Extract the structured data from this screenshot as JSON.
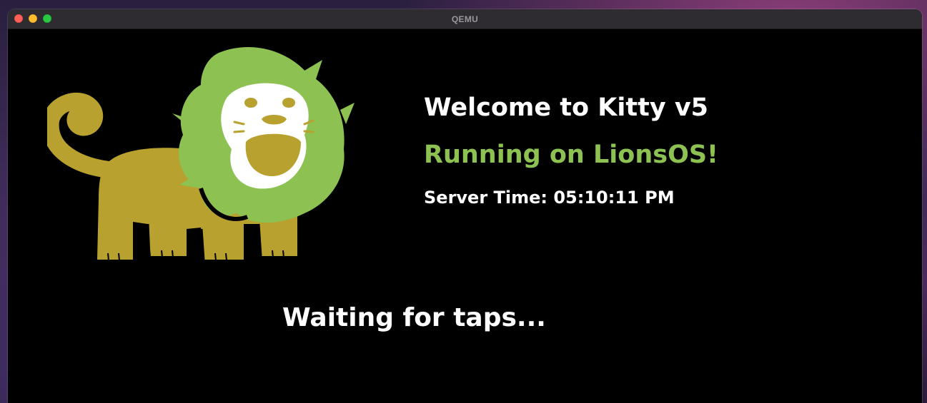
{
  "window": {
    "title": "QEMU"
  },
  "screen": {
    "welcome_text": "Welcome to Kitty v5",
    "running_text": "Running on LionsOS!",
    "server_time_label": "Server Time:",
    "server_time_value": "05:10:11 PM",
    "waiting_text": "Waiting for taps..."
  },
  "colors": {
    "accent_green": "#8dc152",
    "lion_body": "#b8a12e",
    "lion_mane": "#8dc152",
    "text_primary": "#ffffff",
    "screen_bg": "#000000"
  },
  "icons": {
    "logo": "lion-logo-icon"
  }
}
